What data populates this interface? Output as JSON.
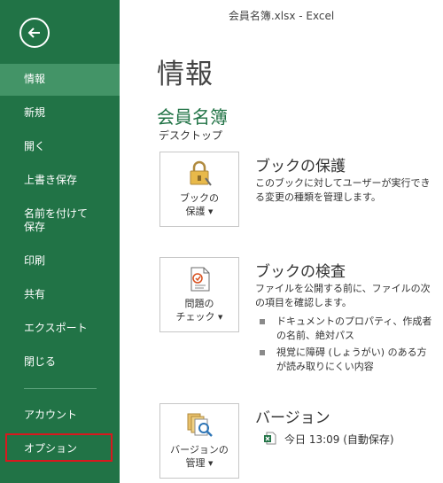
{
  "window": {
    "title": "会員名簿.xlsx - Excel"
  },
  "sidebar": {
    "items": [
      {
        "label": "情報",
        "active": true
      },
      {
        "label": "新規"
      },
      {
        "label": "開く"
      },
      {
        "label": "上書き保存"
      },
      {
        "label": "名前を付けて保存"
      },
      {
        "label": "印刷"
      },
      {
        "label": "共有"
      },
      {
        "label": "エクスポート"
      },
      {
        "label": "閉じる"
      }
    ],
    "footer_items": [
      {
        "label": "アカウント"
      },
      {
        "label": "オプション",
        "highlighted": true
      }
    ]
  },
  "main": {
    "heading": "情報",
    "workbook_name": "会員名簿",
    "location": "デスクトップ",
    "protect": {
      "button_line1": "ブックの",
      "button_line2": "保護",
      "title": "ブックの保護",
      "description": "このブックに対してユーザーが実行できる変更の種類を管理します。"
    },
    "inspect": {
      "button_line1": "問題の",
      "button_line2": "チェック",
      "title": "ブックの検査",
      "description": "ファイルを公開する前に、ファイルの次の項目を確認します。",
      "bullets": [
        "ドキュメントのプロパティ、作成者の名前、絶対パス",
        "視覚に障碍 (しょうがい) のある方が読み取りにくい内容"
      ]
    },
    "versions": {
      "button_line1": "バージョンの",
      "button_line2": "管理",
      "title": "バージョン",
      "entry": "今日 13:09 (自動保存)"
    }
  },
  "colors": {
    "sidebar_bg": "#217346",
    "active_bg": "#439467",
    "accent": "#217346",
    "highlight_border": "#d9181e"
  }
}
